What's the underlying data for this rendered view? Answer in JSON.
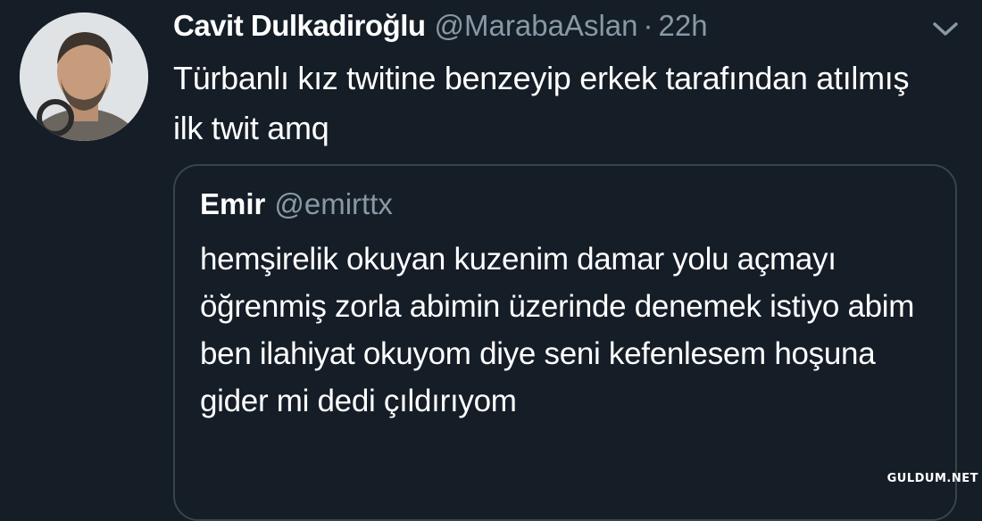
{
  "tweet": {
    "author_name": "Cavit Dulkadiroğlu",
    "author_handle": "@MarabaAslan",
    "separator": "·",
    "time": "22h",
    "text": "Türbanlı kız twitine benzeyip erkek tarafından atılmış ilk twit amq",
    "menu_icon": "chevron-down-icon"
  },
  "quoted_tweet": {
    "author_name": "Emir",
    "author_handle": "@emirttx",
    "text": "hemşirelik okuyan kuzenim damar yolu açmayı öğrenmiş zorla abimin  üzerinde denemek istiyo abim ben ilahiyat okuyom diye seni kefenlesem hoşuna gider mi dedi çıldırıyom"
  },
  "watermark": "GULDUM.NET",
  "colors": {
    "background": "#151d27",
    "primary_text": "#ffffff",
    "secondary_text": "#8899a6",
    "border": "#38444d"
  }
}
